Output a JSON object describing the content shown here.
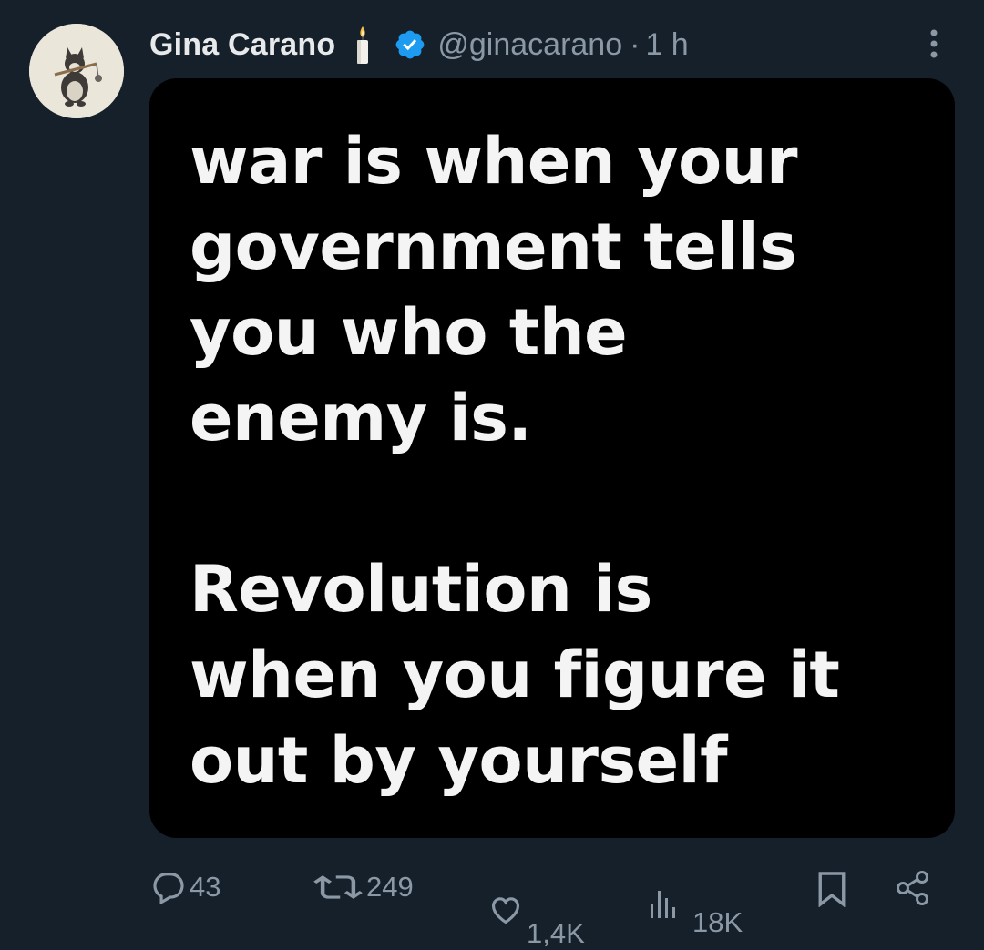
{
  "tweet": {
    "author": {
      "display_name": "Gina Carano",
      "handle": "@ginacarano",
      "separator": "·",
      "timestamp": "1 h",
      "emoji_icon": "candle-icon",
      "verified_icon": "verified-badge-icon",
      "verified_color": "#1d9bf0"
    },
    "media": {
      "lines_top": [
        "war is when your",
        "government tells",
        "you who the",
        "enemy is."
      ],
      "lines_bottom": [
        "Revolution is",
        "when you figure it",
        "out by yourself"
      ]
    },
    "actions": {
      "replies": "43",
      "reposts": "249",
      "likes": "1,4K",
      "views": "18K"
    }
  },
  "colors": {
    "background": "#15202b",
    "primary_text": "#e7e9ea",
    "secondary_text": "#8b98a5",
    "media_background": "#000000"
  }
}
